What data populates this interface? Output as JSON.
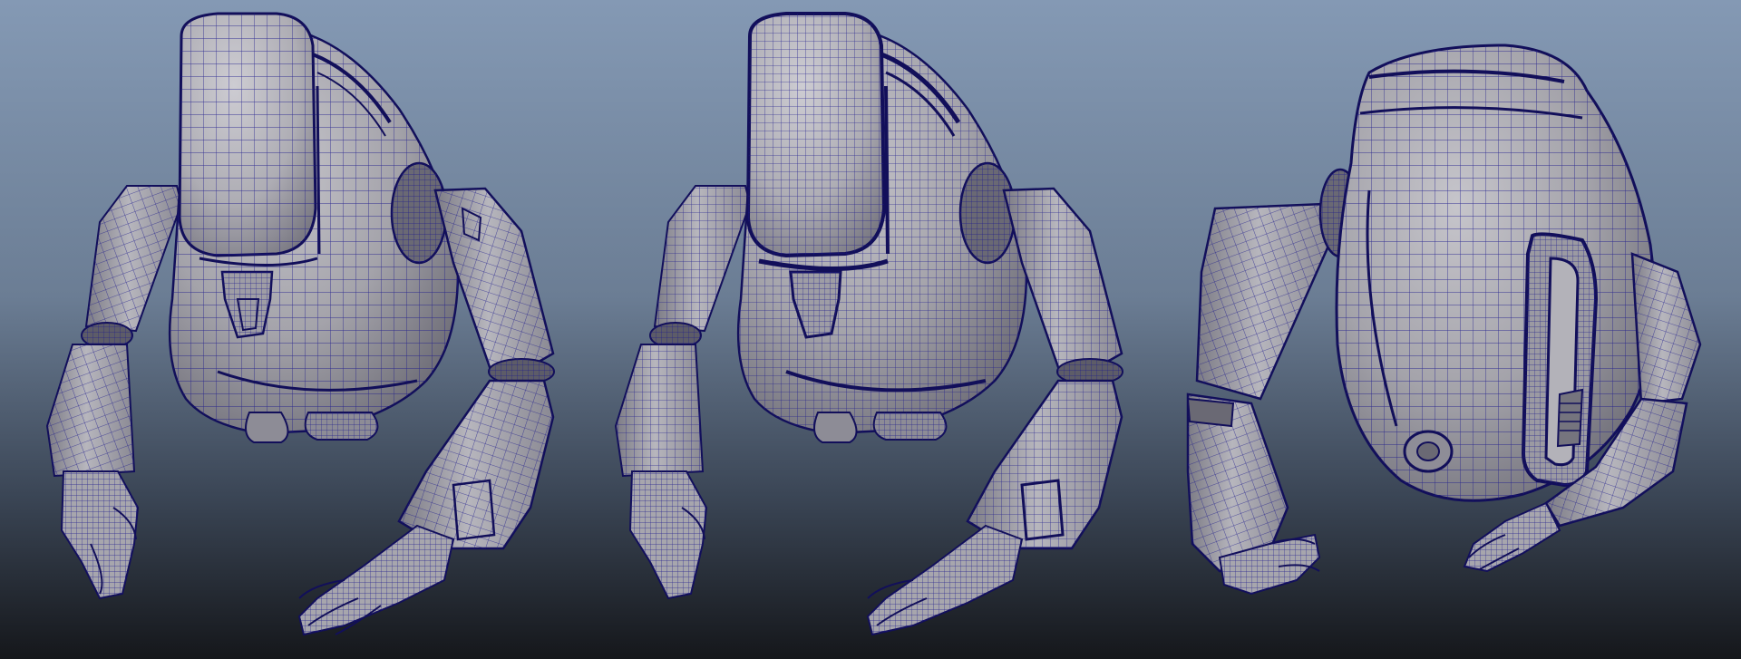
{
  "scene": {
    "description_free": true,
    "background_top": "#8297b2",
    "background_bottom": "#15171b",
    "model_fill": "#a5a4ab",
    "model_fill_light": "#c4c3c9",
    "model_fill_dark": "#6f6f78",
    "wire_color": "#1d1a8c",
    "edge_color": "#120f5a",
    "views": [
      {
        "id": "view-left",
        "density": "medium",
        "mirrored": false
      },
      {
        "id": "view-center",
        "density": "high",
        "mirrored": false
      },
      {
        "id": "view-right",
        "density": "medium",
        "rotated": true
      }
    ]
  }
}
